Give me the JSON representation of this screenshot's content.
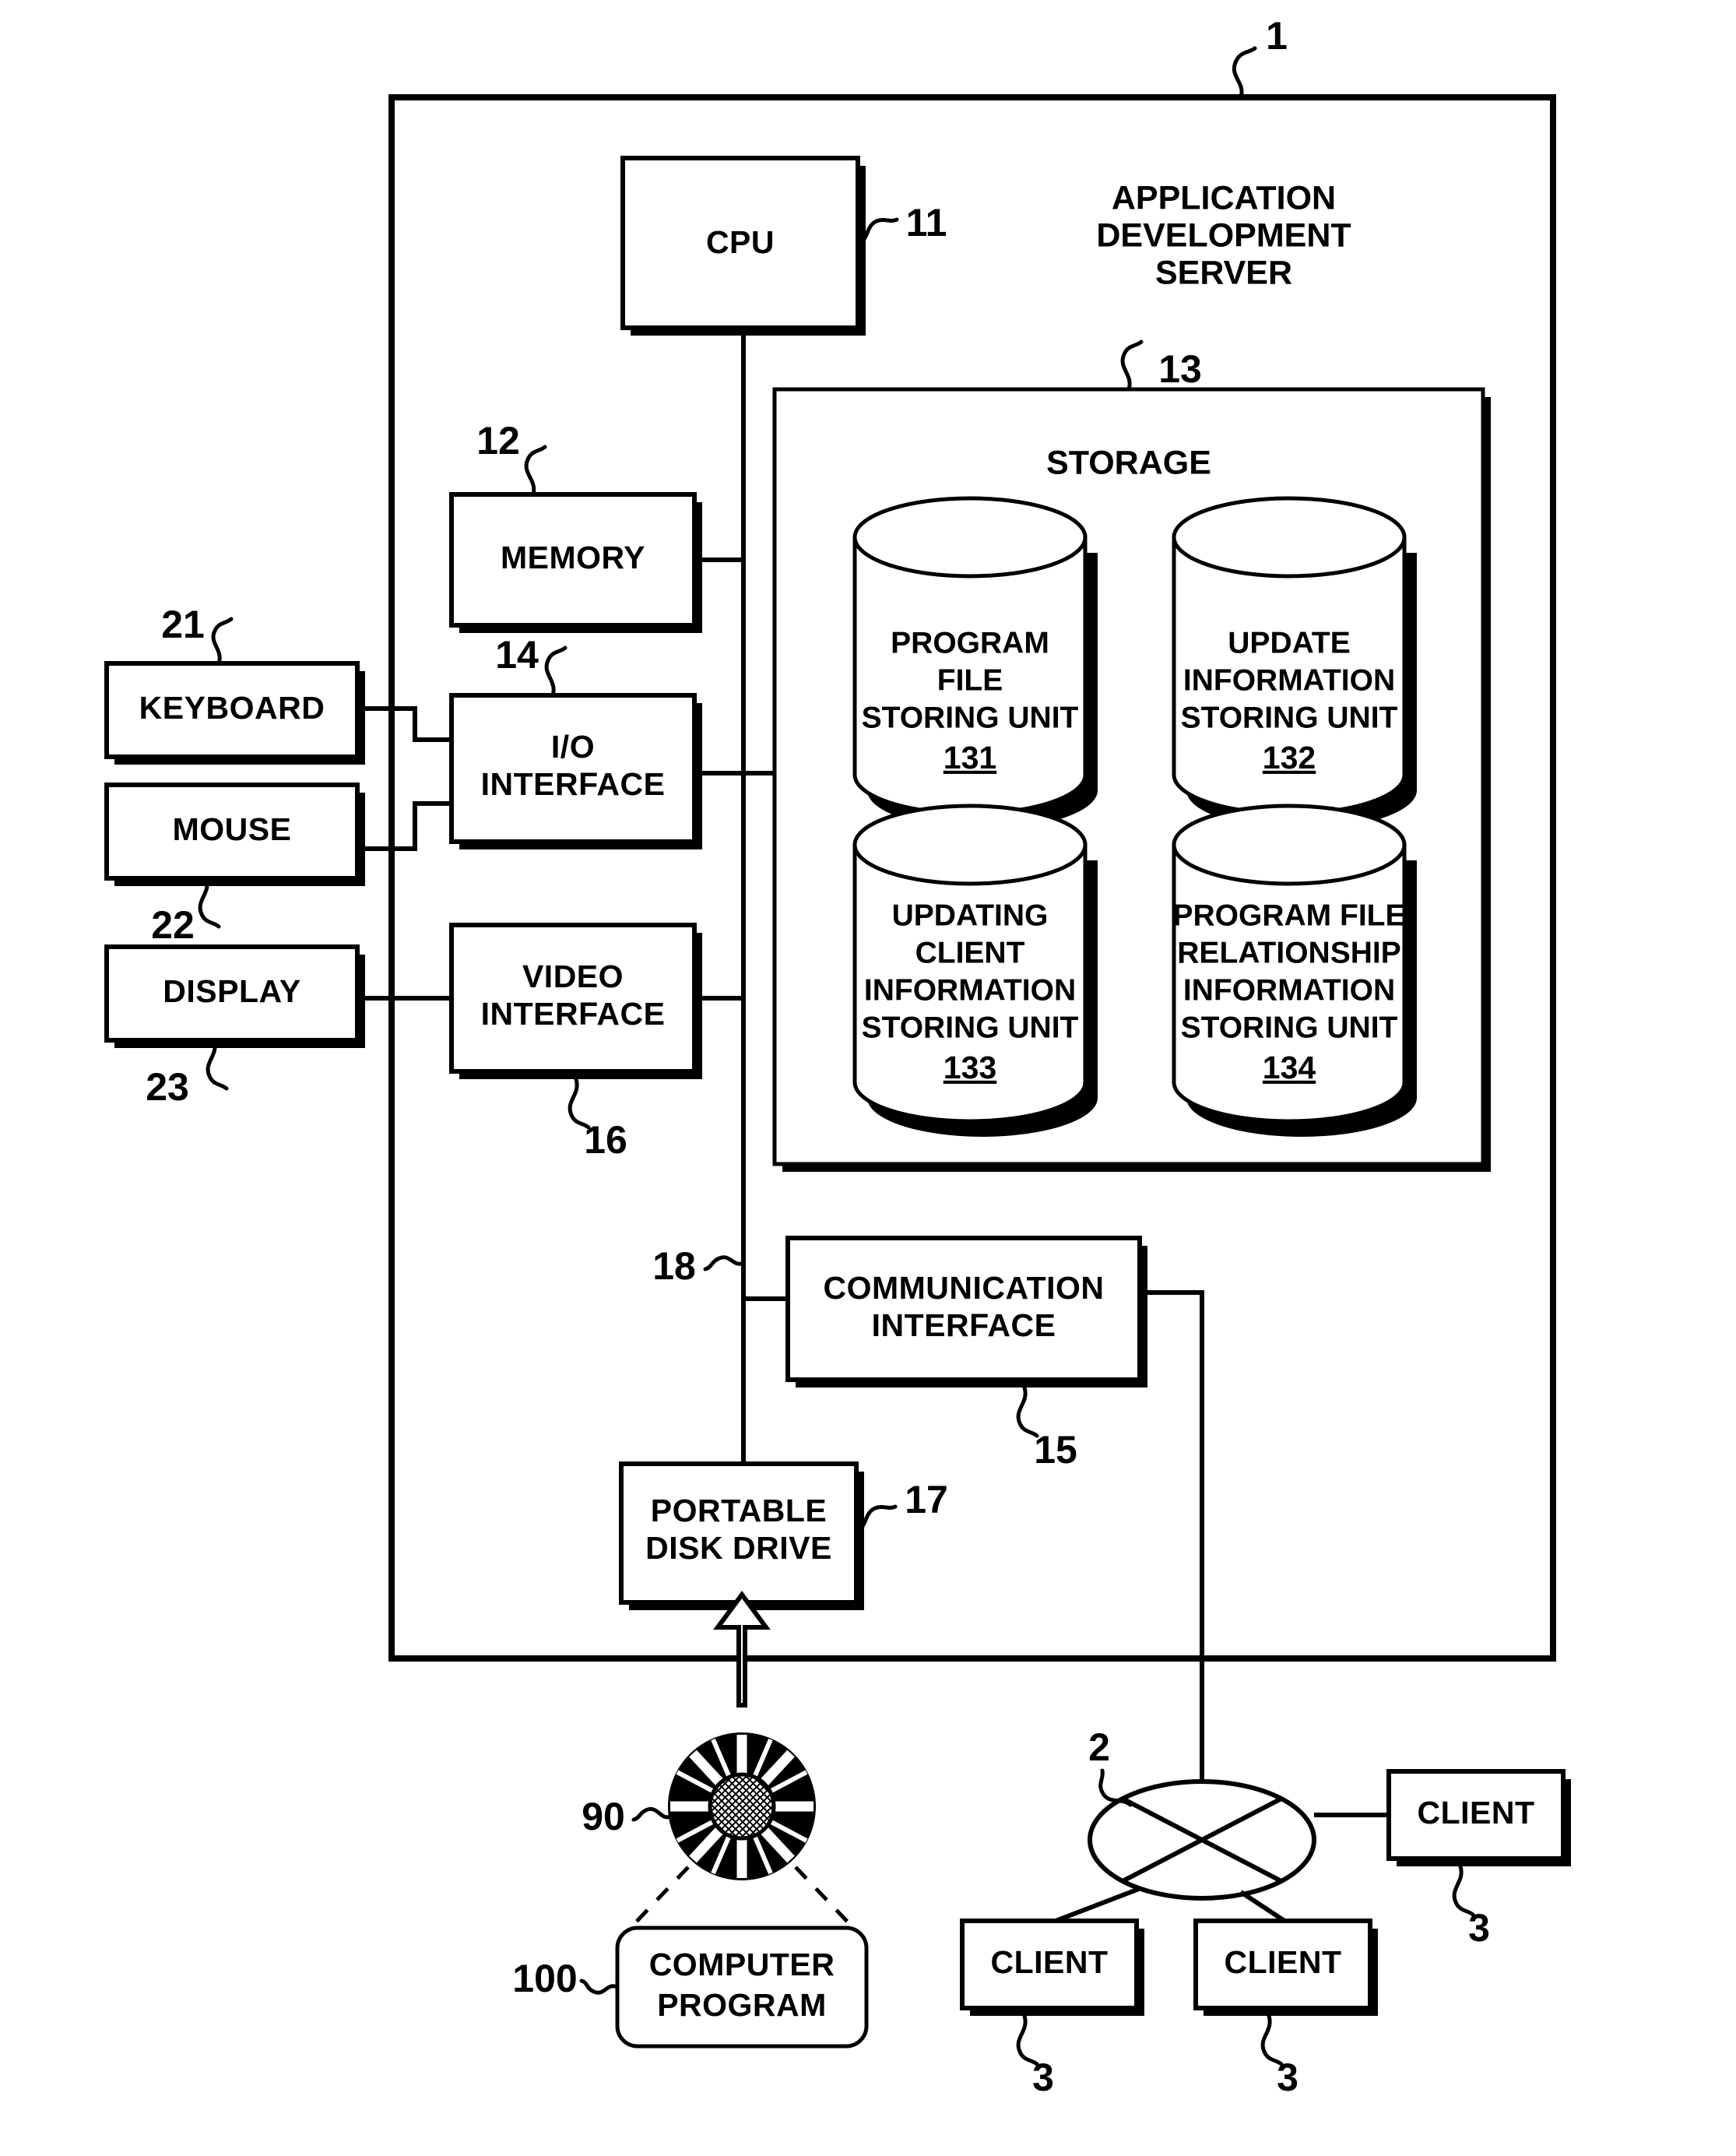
{
  "figure": {
    "title": "Application development server block diagram",
    "frame_label": "1",
    "server_title_lines": [
      "APPLICATION",
      "DEVELOPMENT",
      "SERVER"
    ]
  },
  "components": {
    "cpu": {
      "label": "CPU",
      "ref": "11"
    },
    "memory": {
      "label": "MEMORY",
      "ref": "12"
    },
    "io": {
      "label_line1": "I/O",
      "label_line2": "INTERFACE",
      "ref": "14"
    },
    "video": {
      "label_line1": "VIDEO",
      "label_line2": "INTERFACE",
      "ref": "16"
    },
    "comm": {
      "label_line1": "COMMUNICATION",
      "label_line2": "INTERFACE",
      "ref": "15"
    },
    "disk_drive": {
      "label_line1": "PORTABLE",
      "label_line2": "DISK DRIVE",
      "ref": "17"
    },
    "keyboard": {
      "label": "KEYBOARD",
      "ref": "21"
    },
    "mouse": {
      "label": "MOUSE",
      "ref": "22"
    },
    "display": {
      "label": "DISPLAY",
      "ref": "23"
    },
    "bus": {
      "ref": "18"
    },
    "storage": {
      "label": "STORAGE",
      "ref": "13"
    }
  },
  "storage_units": [
    {
      "lines": [
        "PROGRAM",
        "FILE",
        "STORING UNIT"
      ],
      "ref": "131"
    },
    {
      "lines": [
        "UPDATE",
        "INFORMATION",
        "STORING UNIT"
      ],
      "ref": "132"
    },
    {
      "lines": [
        "UPDATING",
        "CLIENT",
        "INFORMATION",
        "STORING UNIT"
      ],
      "ref": "133"
    },
    {
      "lines": [
        "PROGRAM FILE",
        "RELATIONSHIP",
        "INFORMATION",
        "STORING UNIT"
      ],
      "ref": "134"
    }
  ],
  "media": {
    "disc": {
      "ref": "90"
    },
    "program": {
      "label_line1": "COMPUTER",
      "label_line2": "PROGRAM",
      "ref": "100"
    }
  },
  "network": {
    "cloud_ref": "2",
    "clients": [
      {
        "label": "CLIENT",
        "ref": "3"
      },
      {
        "label": "CLIENT",
        "ref": "3"
      },
      {
        "label": "CLIENT",
        "ref": "3"
      }
    ]
  },
  "colors": {
    "ink": "#000000",
    "paper": "#ffffff"
  }
}
